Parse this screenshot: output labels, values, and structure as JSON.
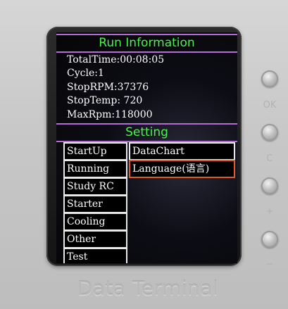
{
  "run_information": {
    "title": "Run Information",
    "lines": [
      "TotalTime:00:08:05",
      "Cycle:1",
      "StopRPM:37376",
      "StopTemp: 720",
      "MaxRpm:118000"
    ]
  },
  "setting": {
    "title": "Setting",
    "left_menu": [
      "StartUp",
      "Running",
      "Study RC",
      "Starter",
      "Cooling",
      "Other",
      "Test"
    ],
    "right_menu": [
      "DataChart",
      "Language(语言)"
    ],
    "selected": "Language(语言)"
  },
  "side_buttons": {
    "labels": [
      "OK",
      "C",
      "+",
      "−"
    ]
  },
  "brand": "Data Terminal",
  "colors": {
    "heading_green": "#49f24e",
    "divider_purple": "#b36cd6",
    "selected_border": "#e35b2a",
    "item_border": "#e8e8e8"
  }
}
